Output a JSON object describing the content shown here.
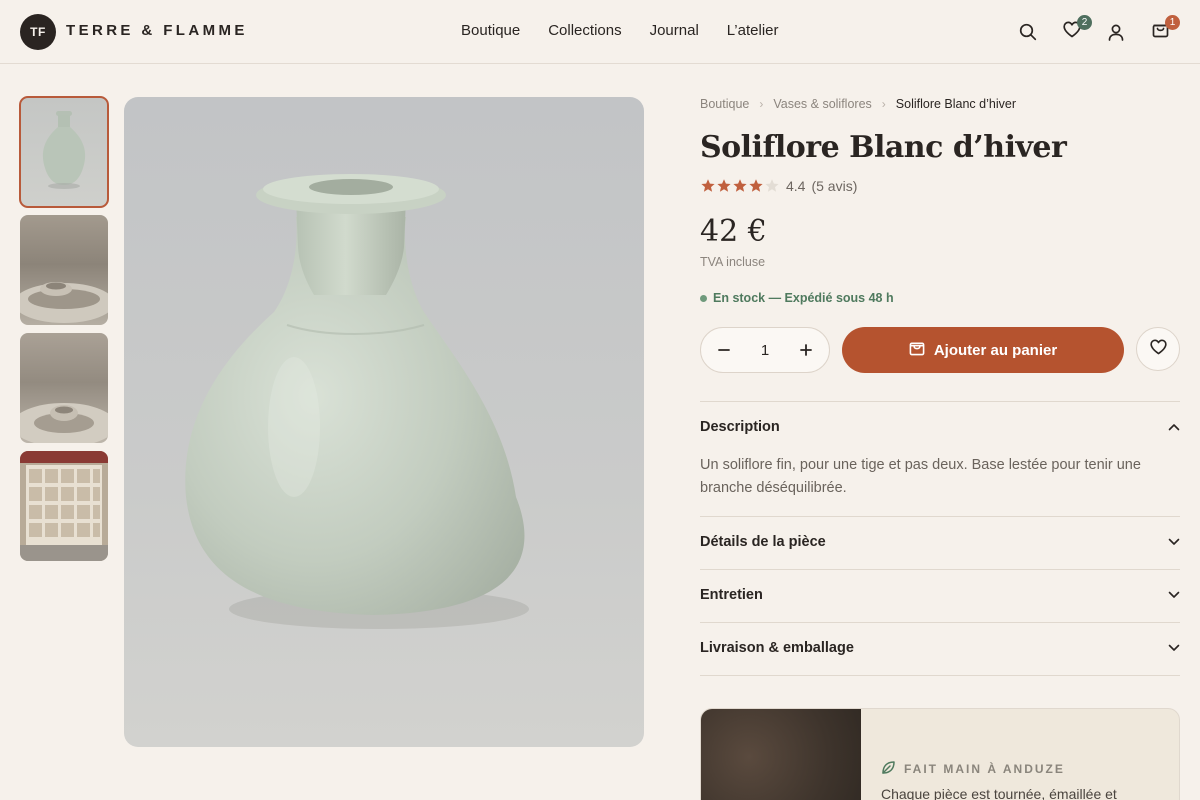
{
  "brand": {
    "monogram": "TF",
    "name": "TERRE & FLAMME"
  },
  "nav": [
    "Boutique",
    "Collections",
    "Journal",
    "L’atelier"
  ],
  "header_icons": {
    "search": "search-icon",
    "wishlist": {
      "icon": "heart-icon",
      "count": "2"
    },
    "account": "user-icon",
    "cart": {
      "icon": "bag-icon",
      "count": "1"
    }
  },
  "colors": {
    "accent": "#b5532f",
    "star": "#c0603e",
    "stock": "#4f7a5e",
    "wishlist_badge": "#4f6f5e",
    "cart_badge": "#c0603e"
  },
  "gallery": {
    "thumbnails": [
      "vase-front",
      "wheel-throwing-1",
      "wheel-throwing-2",
      "atelier-shelves"
    ],
    "active_index": 0
  },
  "breadcrumb": [
    "Boutique",
    "Vases & soliflores",
    "Soliflore Blanc d’hiver"
  ],
  "product": {
    "title": "Soliflore Blanc d’hiver",
    "rating_value": 4.4,
    "rating_text": "4.4",
    "reviews_text": "(5 avis)",
    "price": "42 €",
    "vat": "TVA incluse",
    "stock": "En stock — Expédié sous 48 h",
    "quantity": "1",
    "add_to_cart": "Ajouter au panier"
  },
  "accordion": [
    {
      "title": "Description",
      "expanded": true,
      "body": "Un soliflore fin, pour une tige et pas deux. Base lestée pour tenir une branche déséquilibrée."
    },
    {
      "title": "Détails de la pièce",
      "expanded": false
    },
    {
      "title": "Entretien",
      "expanded": false
    },
    {
      "title": "Livraison & emballage",
      "expanded": false
    }
  ],
  "craft": {
    "kicker": "FAIT MAIN À ANDUZE",
    "text": "Chaque pièce est tournée, émaillée et"
  }
}
